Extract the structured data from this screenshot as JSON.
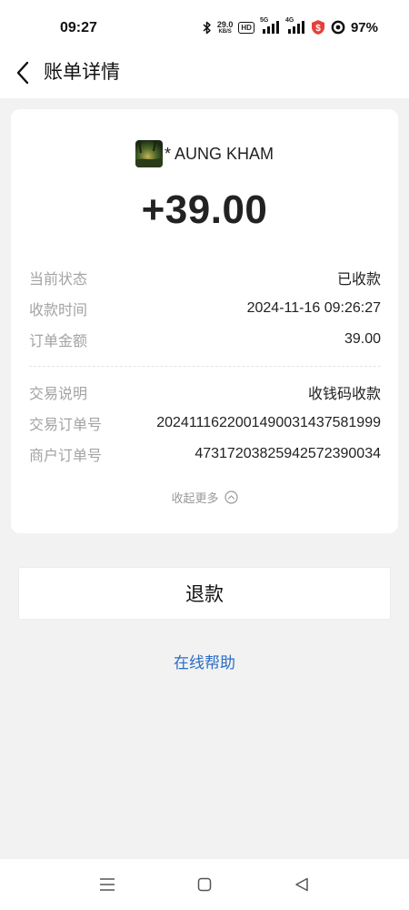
{
  "status_bar": {
    "time": "09:27",
    "net_speed_value": "29.0",
    "net_speed_unit": "KB/S",
    "hd_badge": "HD",
    "signal1_label": "5G",
    "signal2_label": "4G",
    "battery": "97%",
    "icons": [
      "bluetooth-icon",
      "hd-icon",
      "signal-5g-icon",
      "signal-4g-icon",
      "shield-icon",
      "data-saver-icon"
    ],
    "shield_color": "#e5413b"
  },
  "header": {
    "title": "账单详情",
    "back_icon": "chevron-left-icon"
  },
  "bill": {
    "merchant_name": "* AUNG KHAM",
    "amount": "+39.00",
    "group1": [
      {
        "label": "当前状态",
        "value": "已收款"
      },
      {
        "label": "收款时间",
        "value": "2024-11-16 09:26:27"
      },
      {
        "label": "订单金额",
        "value": "39.00"
      }
    ],
    "group2": [
      {
        "label": "交易说明",
        "value": "收钱码收款"
      },
      {
        "label": "交易订单号",
        "value": "2024111622001490031437581999"
      },
      {
        "label": "商户订单号",
        "value": "47317203825942572390034"
      }
    ],
    "collapse_label": "收起更多"
  },
  "actions": {
    "refund_label": "退款",
    "help_label": "在线帮助",
    "link_color": "#2b6cc4"
  },
  "nav_bar": {
    "icons": [
      "menu-icon",
      "home-icon",
      "back-icon"
    ]
  }
}
